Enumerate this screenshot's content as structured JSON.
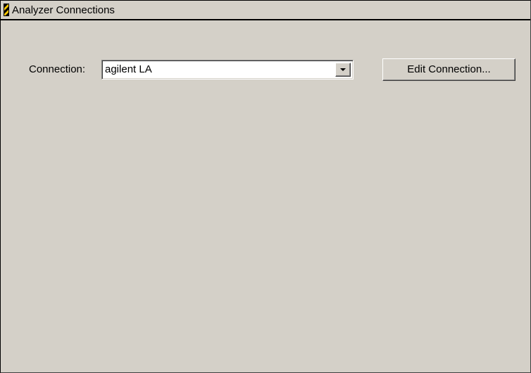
{
  "window": {
    "title": "Analyzer Connections",
    "icon": "analyzer-app-icon"
  },
  "connection": {
    "label": "Connection:",
    "selected": "agilent LA",
    "dropdown_icon": "chevron-down-icon"
  },
  "actions": {
    "edit_connection_label": "Edit Connection..."
  },
  "colors": {
    "background": "#d4d0c8",
    "field": "#ffffff",
    "icon_yellow": "#f5c400"
  }
}
